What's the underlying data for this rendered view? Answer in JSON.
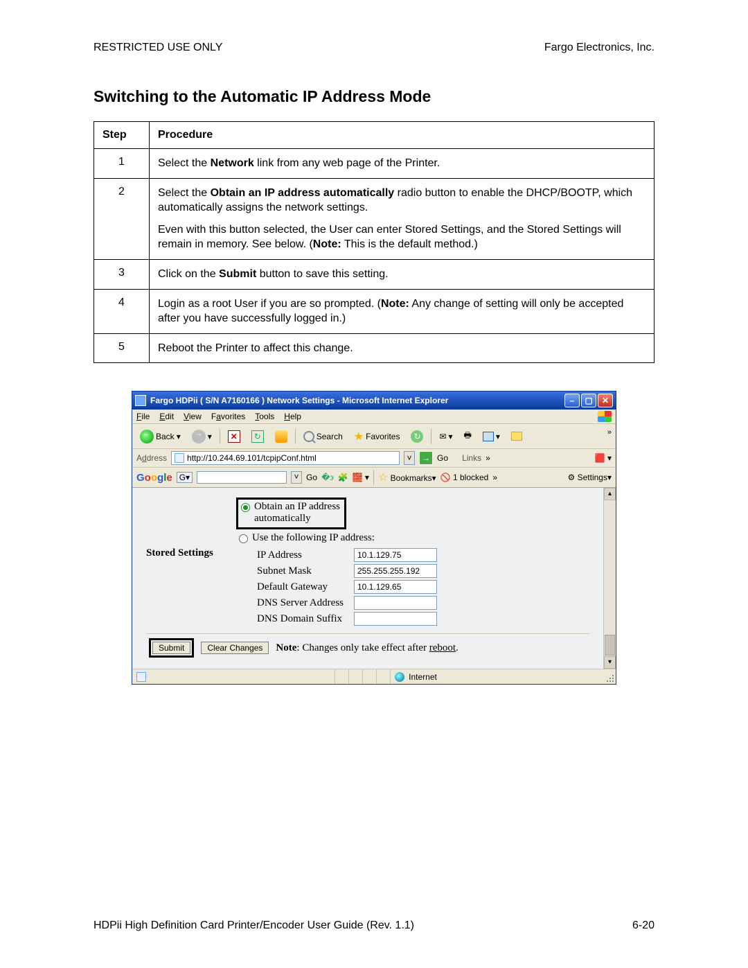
{
  "header": {
    "left": "RESTRICTED USE ONLY",
    "right": "Fargo Electronics, Inc."
  },
  "title": "Switching to the Automatic IP Address Mode",
  "table": {
    "head_step": "Step",
    "head_proc": "Procedure",
    "rows": [
      {
        "step": "1",
        "paras": [
          "Select the <b>Network</b> link from any web page of the Printer."
        ]
      },
      {
        "step": "2",
        "paras": [
          "Select the <b>Obtain an IP address automatically</b> radio button to enable the DHCP/BOOTP, which automatically assigns the network settings.",
          "Even with this button selected, the User can enter Stored Settings, and the Stored Settings will remain in memory. See below. (<b>Note:</b>  This is the default method.)"
        ]
      },
      {
        "step": "3",
        "paras": [
          "Click on the <b>Submit</b> button to save this setting."
        ]
      },
      {
        "step": "4",
        "paras": [
          "Login as a root User if you are so prompted. (<b>Note:</b>  Any change of setting will only be accepted after you have successfully logged in.)"
        ]
      },
      {
        "step": "5",
        "paras": [
          "Reboot the Printer to affect this change."
        ]
      }
    ]
  },
  "ie": {
    "title": "Fargo HDPii ( S/N A7160166 ) Network Settings - Microsoft Internet Explorer",
    "menus": {
      "file": "File",
      "edit": "Edit",
      "view": "View",
      "favorites": "Favorites",
      "tools": "Tools",
      "help": "Help"
    },
    "toolbar": {
      "back": "Back",
      "search": "Search",
      "favorites": "Favorites"
    },
    "address_label": "Address",
    "url": "http://10.244.69.101/tcpipConf.html",
    "go": "Go",
    "links": "Links",
    "google": {
      "go": "Go",
      "bookmarks": "Bookmarks",
      "blocked": "1 blocked",
      "settings": "Settings"
    },
    "content": {
      "radio_auto_line1": "Obtain an IP address",
      "radio_auto_line2": "automatically",
      "radio_manual": "Use the following IP address:",
      "stored": "Stored Settings",
      "fields": {
        "ip_label": "IP Address",
        "ip_value": "10.1.129.75",
        "mask_label": "Subnet Mask",
        "mask_value": "255.255.255.192",
        "gw_label": "Default Gateway",
        "gw_value": "10.1.129.65",
        "dns_label": "DNS Server Address",
        "dns_value": "",
        "suffix_label": "DNS Domain Suffix",
        "suffix_value": ""
      },
      "submit": "Submit",
      "clear": "Clear Changes",
      "note_prefix": "Note",
      "note_rest": ": Changes only take effect after ",
      "note_link": "reboot",
      "note_period": "."
    },
    "status": "Internet"
  },
  "footer": {
    "left": "HDPii High Definition Card Printer/Encoder User Guide (Rev. 1.1)",
    "right": "6-20"
  }
}
